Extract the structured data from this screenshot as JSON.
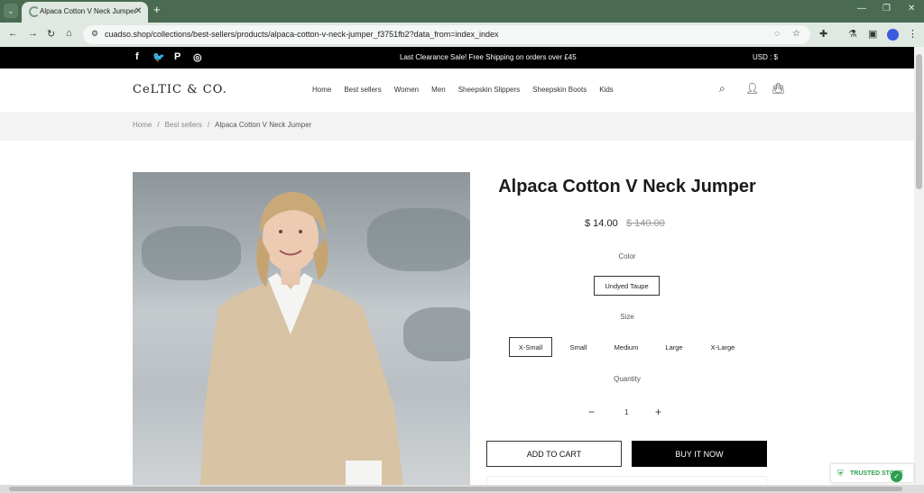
{
  "browser": {
    "tab_title": "Alpaca Cotton V Neck Jumper",
    "url": "cuadso.shop/collections/best-sellers/products/alpaca-cotton-v-neck-jumper_f3751fb2?data_from=index_index",
    "new_tab": "+",
    "tab_close": "✕"
  },
  "announcement": {
    "text": "Last Clearance Sale! Free Shipping on orders over £45",
    "currency": "USD : $",
    "social_icons": [
      "facebook-icon",
      "twitter-icon",
      "pinterest-icon",
      "instagram-icon"
    ]
  },
  "header": {
    "logo": "CeLTIC & CO.",
    "nav": [
      "Home",
      "Best sellers",
      "Women",
      "Men",
      "Sheepskin Slippers",
      "Sheepskin Boots",
      "Kids"
    ]
  },
  "breadcrumb": {
    "home": "Home",
    "sep": "/",
    "collection": "Best sellers",
    "current": "Alpaca Cotton V Neck Jumper"
  },
  "product": {
    "title": "Alpaca Cotton V Neck Jumper",
    "price": "$ 14.00",
    "compare_price": "$ 140.00",
    "color_label": "Color",
    "color_selected": "Undyed Taupe",
    "size_label": "Size",
    "sizes": [
      "X-Small",
      "Small",
      "Medium",
      "Large",
      "X-Large"
    ],
    "size_selected": "X-Small",
    "quantity_label": "Quantity",
    "quantity": "1",
    "add_to_cart": "ADD TO CART",
    "buy_now": "BUY IT NOW"
  },
  "trusted": {
    "label": "TRUSTED STORE"
  },
  "colors": {
    "chrome": "#4a6b52",
    "chrome_light": "#dfe8e1",
    "announce_bg": "#000000",
    "trusted_green": "#2e9e4d"
  }
}
